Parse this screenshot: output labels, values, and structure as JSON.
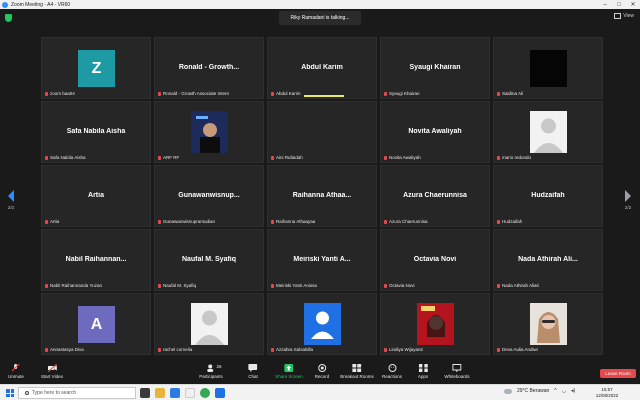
{
  "window": {
    "title": "Zoom Meeting - A4 - VR60"
  },
  "talking": "Riky Ramadani is talking...",
  "view": {
    "label": "View"
  },
  "nav": {
    "left_page": "2/2",
    "right_page": "2/2"
  },
  "tiles": [
    {
      "display": "Z",
      "bg": "#1e9aa4",
      "type": "letter",
      "name": "zoom baa04"
    },
    {
      "display": "Ronald - Growth...",
      "type": "text",
      "name": "Ronald - Growth Associate Intern"
    },
    {
      "display": "Abdul Karim",
      "type": "text",
      "name": "Abdul Karim",
      "speaking": true
    },
    {
      "display": "Syaugi Khairan",
      "type": "text",
      "name": "Syaugi Khairan"
    },
    {
      "display": "",
      "bg": "#050505",
      "type": "letter",
      "name": "Saidina Ali"
    },
    {
      "display": "Safa Nabila Aisha",
      "type": "text",
      "name": "Safa Nabila Aisha"
    },
    {
      "display": "",
      "type": "photo-dark",
      "name": "ARF RF"
    },
    {
      "display": "",
      "type": "blank",
      "name": "Aini Rufaidah"
    },
    {
      "display": "Novita Awaliyah",
      "type": "text",
      "name": "Novita Awaliyah"
    },
    {
      "display": "",
      "type": "avatar-grey",
      "name": "mario redondo"
    },
    {
      "display": "Artia",
      "type": "text",
      "name": "Artia"
    },
    {
      "display": "Gunawanwisnup...",
      "type": "text",
      "name": "Gunawanwisnupramudian"
    },
    {
      "display": "Raihanna Athaa...",
      "type": "text",
      "name": "Raihanna Athaayaa"
    },
    {
      "display": "Azura Chaerunnisa",
      "type": "text",
      "name": "Azura Chaerunnisa"
    },
    {
      "display": "Hudzaifah",
      "type": "text",
      "name": "Hudzaifah"
    },
    {
      "display": "Nabil Raihannan...",
      "type": "text",
      "name": "Nabil Raihannanda Yuzan"
    },
    {
      "display": "Naufal M. Syafiq",
      "type": "text",
      "name": "Naufal M. Syafiq"
    },
    {
      "display": "Meiriski Yanti A...",
      "type": "text",
      "name": "Meiriski Yanti Anissa"
    },
    {
      "display": "Octavia Novi",
      "type": "text",
      "name": "Octavia Novi"
    },
    {
      "display": "Nada Athirah Ali...",
      "type": "text",
      "name": "Nada Athirah Aliati"
    },
    {
      "display": "A",
      "bg": "#6e6bbf",
      "type": "letter",
      "name": "Annastasya Diva"
    },
    {
      "display": "",
      "type": "avatar-grey",
      "name": "rachel cornelia"
    },
    {
      "display": "",
      "type": "avatar-blue",
      "name": "Azzahra Salsabilla"
    },
    {
      "display": "",
      "type": "photo-red",
      "name": "Lindiya Wijayanti"
    },
    {
      "display": "",
      "type": "photo-light",
      "name": "Deva Aulia Andiwi"
    }
  ],
  "toolbar": {
    "unmute": "Unmute",
    "start_video": "Start Video",
    "participants": "Participants",
    "participants_count": "26",
    "chat": "Chat",
    "share_screen": "Share Screen",
    "record": "Record",
    "breakout": "Breakout Rooms",
    "reactions": "Reactions",
    "apps": "Apps",
    "whiteboards": "Whiteboards",
    "leave": "Leave Room"
  },
  "taskbar": {
    "search_placeholder": "Type here to search",
    "weather": "29°C  Berawan",
    "time": "15:57",
    "date": "12/08/2022"
  },
  "colors": {
    "accent": "#2d8cff",
    "leave": "#e5484d",
    "share": "#22c55e"
  }
}
